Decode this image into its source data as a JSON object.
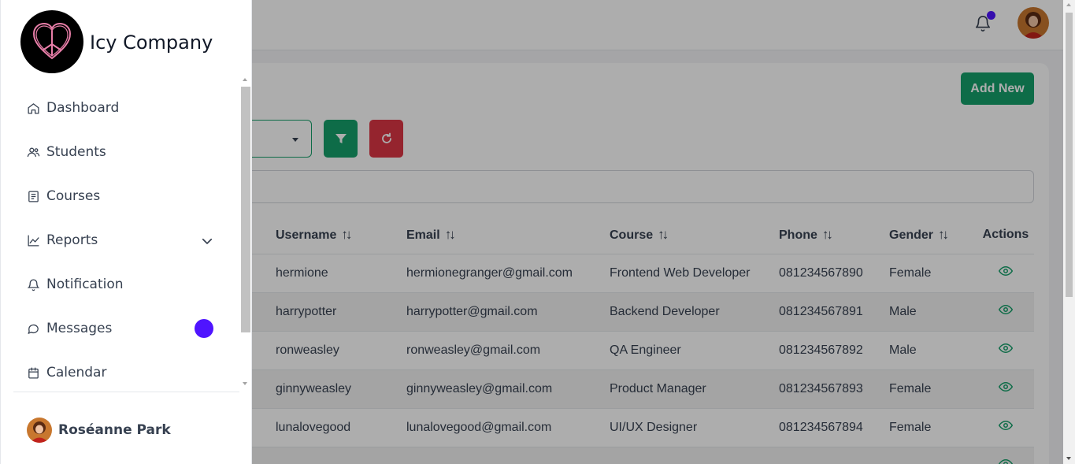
{
  "brand": {
    "name": "Icy Company",
    "logo_icon": "peace-heart-icon"
  },
  "sidebar": {
    "items": [
      {
        "label": "Dashboard",
        "icon": "home-icon"
      },
      {
        "label": "Students",
        "icon": "users-icon"
      },
      {
        "label": "Courses",
        "icon": "book-icon"
      },
      {
        "label": "Reports",
        "icon": "chart-line-icon",
        "expandable": true
      },
      {
        "label": "Notification",
        "icon": "bell-icon"
      },
      {
        "label": "Messages",
        "icon": "chat-icon",
        "badge_color": "#4f14ff"
      },
      {
        "label": "Calendar",
        "icon": "calendar-icon"
      }
    ],
    "user": {
      "name": "Roséanne Park"
    }
  },
  "header": {
    "notification_dot_color": "#4f14ff"
  },
  "toolbar": {
    "add_label": "Add New",
    "accent_color": "#16a06a",
    "danger_color": "#dc3545"
  },
  "table": {
    "columns": [
      "Username",
      "Email",
      "Course",
      "Phone",
      "Gender",
      "Actions"
    ],
    "rows": [
      {
        "username": "hermione",
        "email": "hermionegranger@gmail.com",
        "course": "Frontend Web Developer",
        "phone": "081234567890",
        "gender": "Female"
      },
      {
        "username": "harrypotter",
        "email": "harrypotter@gmail.com",
        "course": "Backend Developer",
        "phone": "081234567891",
        "gender": "Male"
      },
      {
        "username": "ronweasley",
        "email": "ronweasley@gmail.com",
        "course": "QA Engineer",
        "phone": "081234567892",
        "gender": "Male"
      },
      {
        "username": "ginnyweasley",
        "email": "ginnyweasley@gmail.com",
        "course": "Product Manager",
        "phone": "081234567893",
        "gender": "Female"
      },
      {
        "username": "lunalovegood",
        "email": "lunalovegood@gmail.com",
        "course": "UI/UX Designer",
        "phone": "081234567894",
        "gender": "Female"
      }
    ]
  }
}
